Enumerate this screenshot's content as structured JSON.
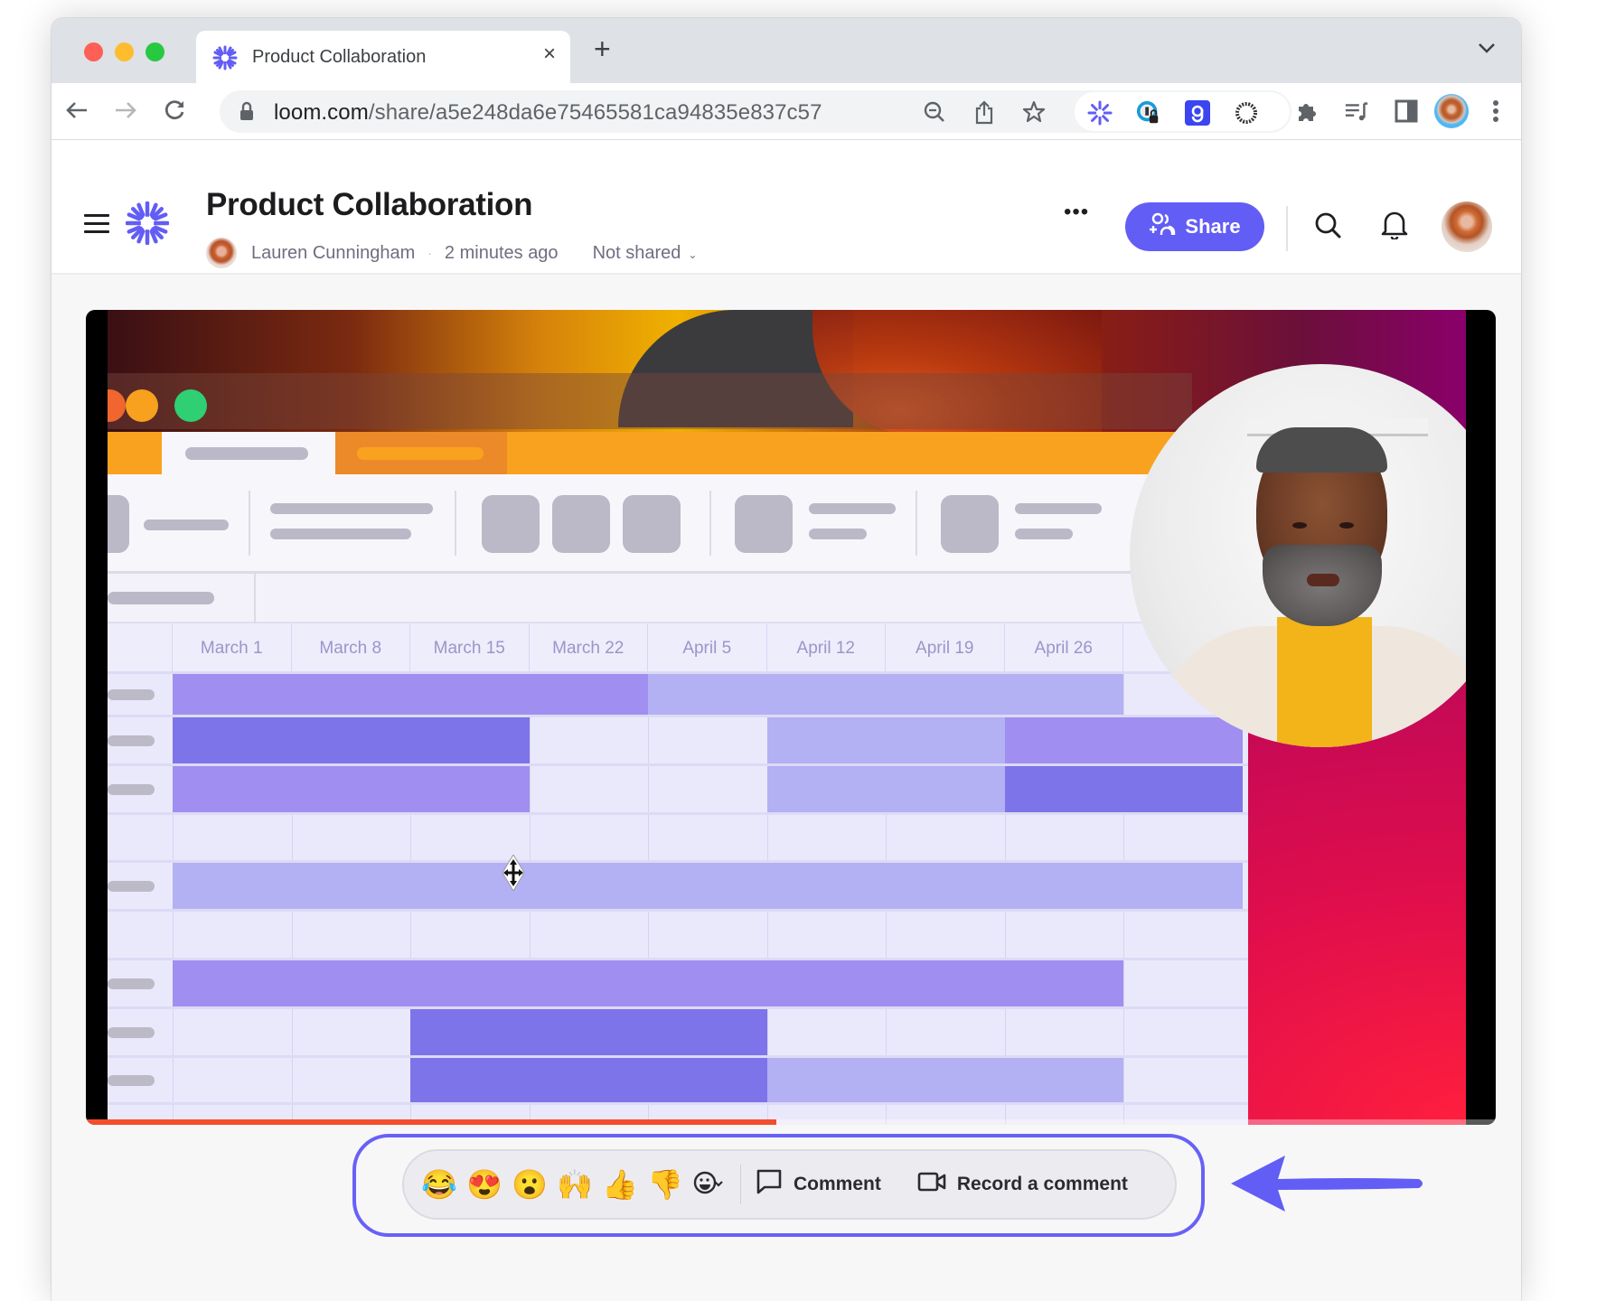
{
  "browser": {
    "tab_title": "Product Collaboration",
    "tab_close": "×",
    "new_tab": "+",
    "url_host": "loom.com",
    "url_path": "/share/a5e248da6e75465581ca94835e837c57",
    "icons": [
      "back-icon",
      "forward-icon",
      "reload-icon",
      "lock-icon",
      "zoom-out-icon",
      "share-icon",
      "bookmark-star-icon",
      "loom-extension-icon",
      "password-manager-extension-icon",
      "grammarly-extension-icon",
      "sun-extension-icon",
      "extensions-puzzle-icon",
      "media-controls-icon",
      "side-panel-icon",
      "profile-avatar",
      "browser-menu-icon"
    ]
  },
  "header": {
    "title": "Product Collaboration",
    "author": "Lauren Cunningham",
    "separator": "·",
    "time_ago": "2 minutes ago",
    "sharing_status": "Not shared",
    "more_label": "•••",
    "share_label": "Share"
  },
  "video": {
    "progress": 0.49,
    "gantt_columns": [
      "March 1",
      "March 8",
      "March 15",
      "March 22",
      "April 5",
      "April 12",
      "April 19",
      "April 26"
    ]
  },
  "reactions": {
    "emojis": [
      "😂",
      "😍",
      "😮",
      "🙌",
      "👍",
      "👎"
    ],
    "emoji_names": [
      "tears-of-joy",
      "heart-eyes",
      "surprised",
      "raised-hands",
      "thumbs-up",
      "thumbs-down"
    ],
    "comment_label": "Comment",
    "record_label": "Record a comment"
  },
  "colors": {
    "accent": "#625df5",
    "highlight": "#6761f7",
    "progress": "#f44d2c"
  }
}
